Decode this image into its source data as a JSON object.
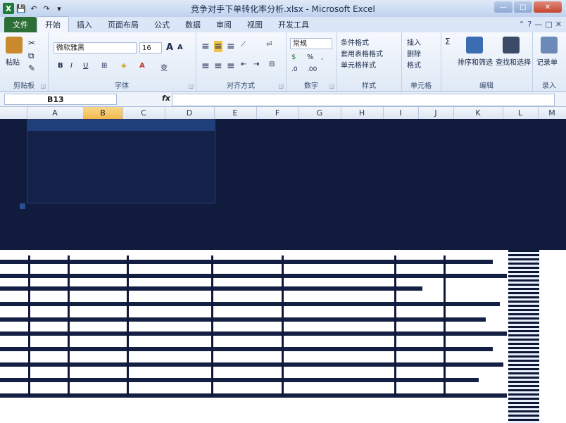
{
  "window": {
    "title": "竞争对手下单转化率分析.xlsx - Microsoft Excel",
    "qat": [
      "X",
      "💾",
      "↶",
      "↷",
      "▾"
    ],
    "controls": [
      "—",
      "□",
      "✕"
    ]
  },
  "tabs": [
    "文件",
    "开始",
    "插入",
    "页面布局",
    "公式",
    "数据",
    "审阅",
    "视图",
    "开发工具"
  ],
  "tabs_right": [
    "⌃",
    "?",
    "—",
    "□",
    "✕"
  ],
  "ribbon": {
    "clipboard": {
      "label": "剪贴板",
      "paste": "粘贴"
    },
    "font": {
      "label": "字体",
      "name": "微软雅黑",
      "size": "16",
      "grow": "A",
      "shrink": "A",
      "bold": "B",
      "italic": "I",
      "underline": "U",
      "border": "⊞",
      "fill": "◈",
      "color": "A",
      "phonetic": "变"
    },
    "align": {
      "label": "对齐方式"
    },
    "number": {
      "label": "数字",
      "format": "常规",
      "currency": "%",
      "comma": ",",
      "inc": ".0",
      "dec": ".00"
    },
    "styles": {
      "label": "样式",
      "items": [
        "条件格式",
        "套用表格格式",
        "单元格样式"
      ]
    },
    "cells": {
      "label": "单元格",
      "items": [
        "插入",
        "删除",
        "格式"
      ]
    },
    "editing": {
      "label": "编辑",
      "sum": "Σ",
      "sort": "排序和筛选",
      "find": "查找和选择"
    },
    "record": {
      "label": "录入",
      "item": "记录单"
    }
  },
  "formula_bar": {
    "name_box": "B13",
    "fx": "fx",
    "value": ""
  },
  "columns": [
    "A",
    "B",
    "C",
    "D",
    "E",
    "F",
    "G",
    "H",
    "I",
    "J",
    "K",
    "L",
    "M"
  ],
  "selected_column": "B",
  "colors": {
    "accent": "#2c6e35",
    "selection": "#f3b84c"
  }
}
